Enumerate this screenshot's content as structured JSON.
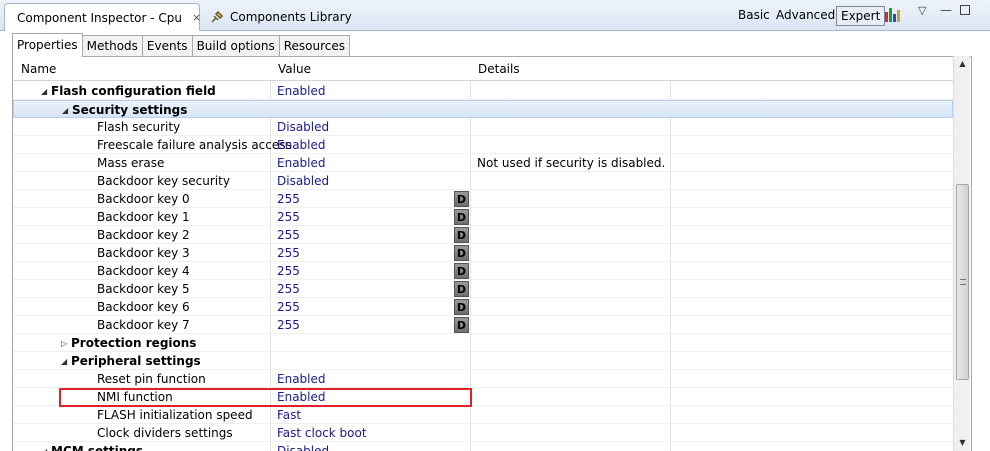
{
  "view_tabs": [
    {
      "label": "Component Inspector - Cpu",
      "icon": "plug-icon",
      "active": true
    },
    {
      "label": "Components Library",
      "icon": "plug-icon",
      "active": false
    }
  ],
  "modes": {
    "basic": "Basic",
    "advanced": "Advanced",
    "expert": "Expert",
    "selected": "Expert"
  },
  "sub_tabs": [
    "Properties",
    "Methods",
    "Events",
    "Build options",
    "Resources"
  ],
  "columns": {
    "name": "Name",
    "value": "Value",
    "details": "Details"
  },
  "rows": [
    {
      "name": "Flash configuration field",
      "value": "Enabled",
      "details": "",
      "level": 1,
      "bold": true,
      "expander": "expanded"
    },
    {
      "name": "Security settings",
      "value": "",
      "details": "",
      "level": 2,
      "bold": true,
      "expander": "expanded",
      "highlighted": true
    },
    {
      "name": "Flash security",
      "value": "Disabled",
      "details": "",
      "level": 3
    },
    {
      "name": "Freescale failure analysis access",
      "value": "Enabled",
      "details": "",
      "level": 3
    },
    {
      "name": "Mass erase",
      "value": "Enabled",
      "details": "Not used if security is disabled.",
      "level": 3
    },
    {
      "name": "Backdoor key security",
      "value": "Disabled",
      "details": "",
      "level": 3
    },
    {
      "name": "Backdoor key 0",
      "value": "255",
      "details": "",
      "level": 3,
      "dbutton": "D"
    },
    {
      "name": "Backdoor key 1",
      "value": "255",
      "details": "",
      "level": 3,
      "dbutton": "D"
    },
    {
      "name": "Backdoor key 2",
      "value": "255",
      "details": "",
      "level": 3,
      "dbutton": "D"
    },
    {
      "name": "Backdoor key 3",
      "value": "255",
      "details": "",
      "level": 3,
      "dbutton": "D"
    },
    {
      "name": "Backdoor key 4",
      "value": "255",
      "details": "",
      "level": 3,
      "dbutton": "D"
    },
    {
      "name": "Backdoor key 5",
      "value": "255",
      "details": "",
      "level": 3,
      "dbutton": "D"
    },
    {
      "name": "Backdoor key 6",
      "value": "255",
      "details": "",
      "level": 3,
      "dbutton": "D"
    },
    {
      "name": "Backdoor key 7",
      "value": "255",
      "details": "",
      "level": 3,
      "dbutton": "D"
    },
    {
      "name": "Protection regions",
      "value": "",
      "details": "",
      "level": 2,
      "bold": true,
      "expander": "collapsed"
    },
    {
      "name": "Peripheral settings",
      "value": "",
      "details": "",
      "level": 2,
      "bold": true,
      "expander": "expanded"
    },
    {
      "name": "Reset pin function",
      "value": "Enabled",
      "details": "",
      "level": 3
    },
    {
      "name": "NMI function",
      "value": "Enabled",
      "details": "",
      "level": 3,
      "annotated": true
    },
    {
      "name": "FLASH initialization speed",
      "value": "Fast",
      "details": "",
      "level": 3
    },
    {
      "name": "Clock dividers settings",
      "value": "Fast clock boot",
      "details": "",
      "level": 3
    },
    {
      "name": "MCM settings",
      "value": "Disabled",
      "details": "",
      "level": 1,
      "bold": true,
      "expander": "expanded"
    }
  ],
  "colors": {
    "annotation": "#e0202a",
    "value_text": "#1a1a8c",
    "highlight": "#d7e5f7"
  }
}
